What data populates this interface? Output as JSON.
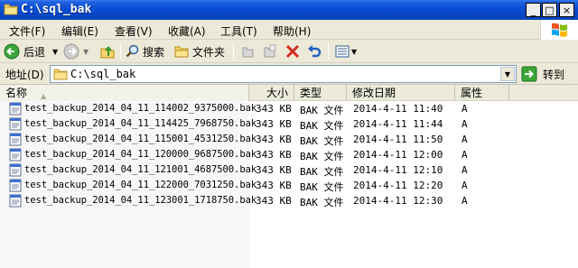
{
  "window": {
    "title": "C:\\sql_bak",
    "minimize_label": "_",
    "maximize_label": "□",
    "close_label": "×"
  },
  "menu": {
    "items": [
      {
        "label": "文件(F)"
      },
      {
        "label": "编辑(E)"
      },
      {
        "label": "查看(V)"
      },
      {
        "label": "收藏(A)"
      },
      {
        "label": "工具(T)"
      },
      {
        "label": "帮助(H)"
      }
    ]
  },
  "toolbar": {
    "back_label": "后退",
    "search_label": "搜索",
    "folders_label": "文件夹"
  },
  "address": {
    "label": "地址(D)",
    "value": "C:\\sql_bak",
    "go_label": "转到"
  },
  "list": {
    "columns": [
      "名称",
      "大小",
      "类型",
      "修改日期",
      "属性"
    ],
    "rows": [
      {
        "name": "test_backup_2014_04_11_114002_9375000.bak",
        "size": "343 KB",
        "type": "BAK 文件",
        "date": "2014-4-11 11:40",
        "attr": "A"
      },
      {
        "name": "test_backup_2014_04_11_114425_7968750.bak",
        "size": "343 KB",
        "type": "BAK 文件",
        "date": "2014-4-11 11:44",
        "attr": "A"
      },
      {
        "name": "test_backup_2014_04_11_115001_4531250.bak",
        "size": "343 KB",
        "type": "BAK 文件",
        "date": "2014-4-11 11:50",
        "attr": "A"
      },
      {
        "name": "test_backup_2014_04_11_120000_9687500.bak",
        "size": "343 KB",
        "type": "BAK 文件",
        "date": "2014-4-11 12:00",
        "attr": "A"
      },
      {
        "name": "test_backup_2014_04_11_121001_4687500.bak",
        "size": "343 KB",
        "type": "BAK 文件",
        "date": "2014-4-11 12:10",
        "attr": "A"
      },
      {
        "name": "test_backup_2014_04_11_122000_7031250.bak",
        "size": "343 KB",
        "type": "BAK 文件",
        "date": "2014-4-11 12:20",
        "attr": "A"
      },
      {
        "name": "test_backup_2014_04_11_123001_1718750.bak",
        "size": "343 KB",
        "type": "BAK 文件",
        "date": "2014-4-11 12:30",
        "attr": "A"
      }
    ]
  },
  "colors": {
    "titlebar": "#0a4fd6",
    "chrome": "#ece9d8",
    "header": "#ebeadb"
  }
}
